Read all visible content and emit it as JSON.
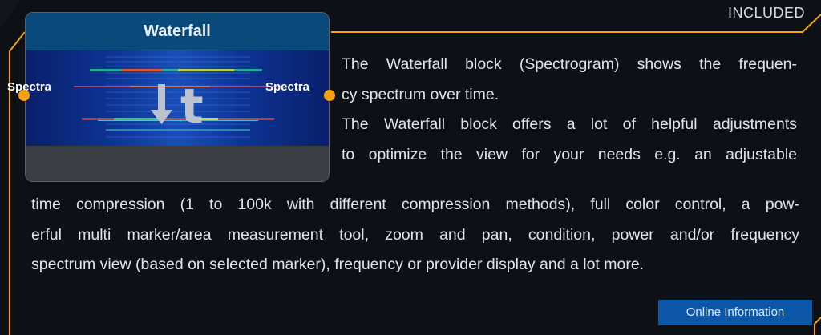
{
  "badge": "INCLUDED",
  "block": {
    "title": "Waterfall",
    "input_label": "Spectra",
    "output_label": "Spectra",
    "time_glyph": "t"
  },
  "description": {
    "l1": "The Waterfall block (Spectrogram) shows the frequen-",
    "l2": "cy spectrum over time.",
    "l3": "The Waterfall block offers a lot of helpful adjustments",
    "l4": "to optimize the view for your needs e.g. an adjustable",
    "l5": "time compression (1 to 100k with different compression methods), full color control, a pow-",
    "l6": "erful multi marker/area measurement tool, zoom and pan, condition, power and/or frequency",
    "l7": "spectrum view (based on selected marker), frequency or provider display and a lot more."
  },
  "online_button": "Online Information",
  "colors": {
    "accent": "#f5a10d",
    "button": "#0d57a8",
    "header": "#0a4a7a",
    "background": "#0d1015"
  }
}
